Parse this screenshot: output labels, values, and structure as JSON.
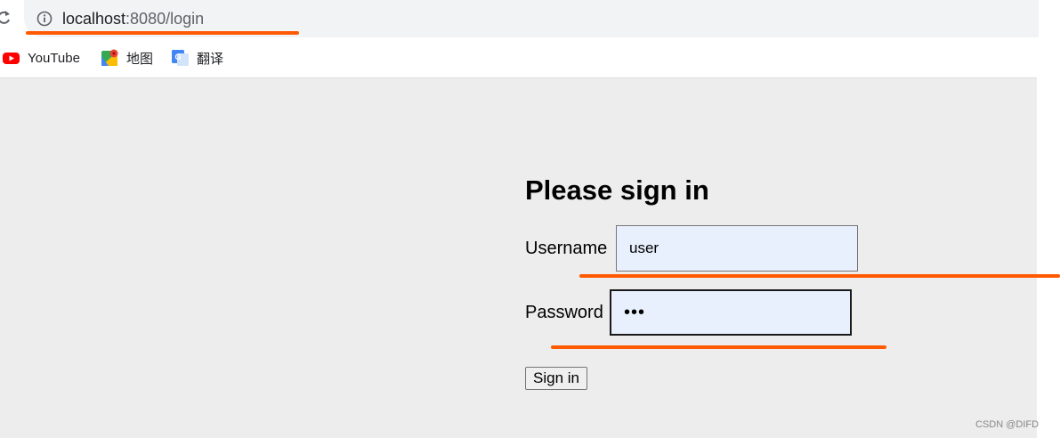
{
  "browser": {
    "url_host": "localhost",
    "url_rest": ":8080/login",
    "bookmarks": [
      {
        "label": "YouTube",
        "icon": "youtube-icon"
      },
      {
        "label": "地图",
        "icon": "maps-icon"
      },
      {
        "label": "翻译",
        "icon": "translate-icon"
      }
    ]
  },
  "login": {
    "heading": "Please sign in",
    "username_label": "Username",
    "username_value": "user",
    "password_label": "Password",
    "password_value": "•••",
    "submit_label": "Sign in"
  },
  "annotation_color": "#ff5a00",
  "watermark": "CSDN @DIFD"
}
